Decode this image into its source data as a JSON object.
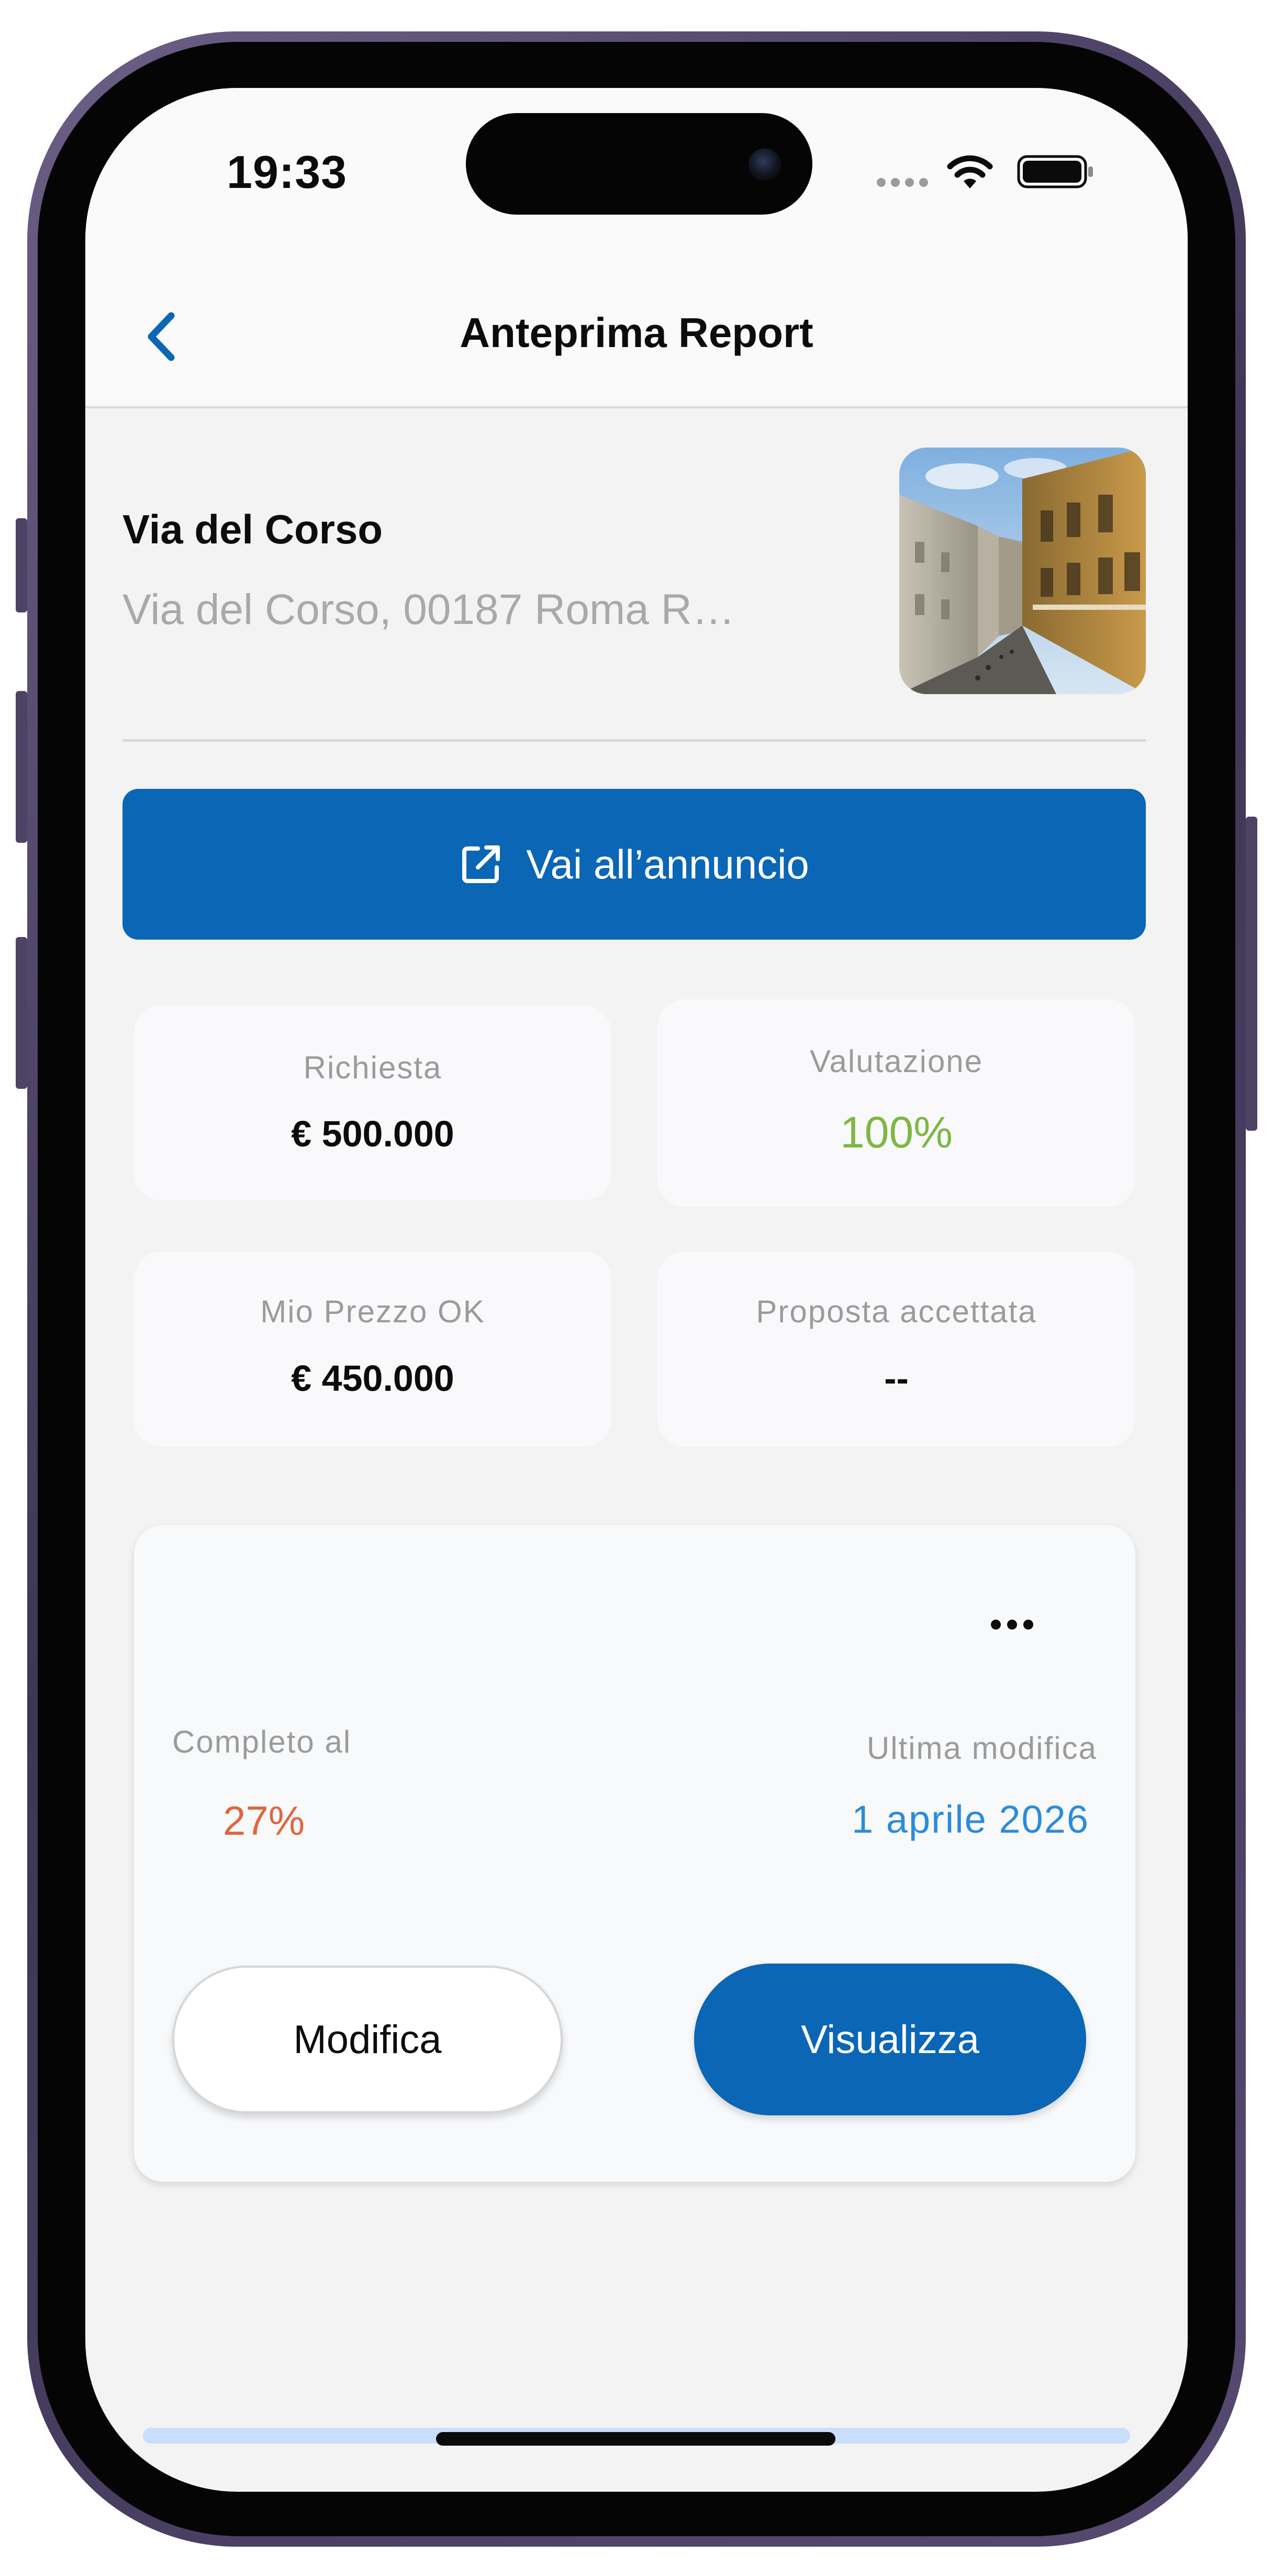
{
  "status_bar": {
    "time": "19:33",
    "signal_icon": "signal-dots-icon",
    "wifi_icon": "wifi-icon",
    "battery_icon": "battery-full-icon"
  },
  "header": {
    "title": "Anteprima Report",
    "back_icon": "chevron-left-icon"
  },
  "property": {
    "name": "Via del Corso",
    "address": "Via del Corso, 00187 Roma R…",
    "thumbnail": "street-photo"
  },
  "listing_button": {
    "label": "Vai all’annuncio",
    "icon": "external-link-icon"
  },
  "stats": [
    {
      "label": "Richiesta",
      "value": "€ 500.000"
    },
    {
      "label": "Valutazione",
      "value": "100%",
      "value_color": "#7cb843"
    },
    {
      "label": "Mio Prezzo OK",
      "value": "€ 450.000"
    },
    {
      "label": "Proposta accettata",
      "value": "--"
    }
  ],
  "report": {
    "more_icon": "ellipsis-icon",
    "completion_label": "Completo al",
    "completion_value": "27%",
    "completion_color": "#e0663f",
    "modified_label": "Ultima modifica",
    "modified_value": "1 aprile 2026",
    "modified_color": "#2c8bdb",
    "edit_label": "Modifica",
    "view_label": "Visualizza"
  },
  "colors": {
    "primary": "#0b66b5",
    "background": "#f3f3f3",
    "card": "#f9f9fb"
  }
}
